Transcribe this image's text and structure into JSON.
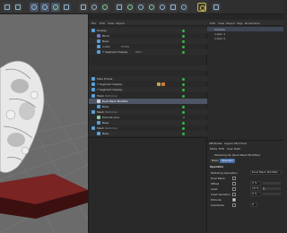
{
  "object_manager": {
    "menu": [
      "File",
      "Edit",
      "View",
      "Object"
    ],
    "rows": [
      {
        "name": "Display",
        "tag": ""
      },
      {
        "name": "Bend",
        "tag": ""
      },
      {
        "name": "Base",
        "tag": ""
      },
      {
        "name": "n-Gon",
        "tag": "Profile"
      },
      {
        "name": "7 Segment Display",
        "tag": "Path"
      },
      {
        "name": "",
        "tag": ""
      },
      {
        "name": "Plexi Frame",
        "tag": ""
      },
      {
        "name": "7 Segment Display",
        "tag": ""
      },
      {
        "name": "7 Segment Display",
        "tag": ""
      },
      {
        "name": "Mesh",
        "tag": "Deformer"
      },
      {
        "name": "Dual Mesh Modifier",
        "tag": ""
      },
      {
        "name": "Base",
        "tag": ""
      },
      {
        "name": "Mesh",
        "tag": "Deformer"
      },
      {
        "name": "Extrude Line",
        "tag": "2"
      },
      {
        "name": "Base",
        "tag": ""
      },
      {
        "name": "Mesh",
        "tag": "Deformer"
      },
      {
        "name": "Base",
        "tag": ""
      }
    ]
  },
  "right_panel": {
    "menu": [
      "Edit",
      "View",
      "Object",
      "Tags",
      "Bookmarks"
    ],
    "items": [
      "Camera",
      "n-Gon 1",
      "n-Gon 2"
    ]
  },
  "attribute_manager": {
    "top_tabs": [
      "Attributes",
      "Layers",
      "Structure"
    ],
    "menu": [
      "Mode",
      "Edit",
      "User Data"
    ],
    "title": "Modeling Op (Dual Mesh Modifier)",
    "tabs": [
      "Basic",
      "Operator"
    ],
    "section": "Operator",
    "params": [
      {
        "label": "Modeling Operation",
        "value": "Dual Mesh Modifier"
      },
      {
        "label": "Dual Mesh",
        "value": ""
      },
      {
        "label": "Offset",
        "value": "0 %"
      },
      {
        "label": "Inset",
        "value": "10 %"
      },
      {
        "label": "Inset Variation",
        "value": "0 %"
      },
      {
        "label": "Extrude",
        "value": ""
      },
      {
        "label": "Subdivide",
        "value": "0"
      }
    ],
    "offset_fill": 0,
    "inset_fill": 0.1,
    "inset_var_fill": 0
  },
  "colors": {
    "selection": "#4e5666",
    "accent_blue": "#4b6fa8",
    "green_check": "#3bb54a",
    "frame_red": "#6b2020"
  }
}
